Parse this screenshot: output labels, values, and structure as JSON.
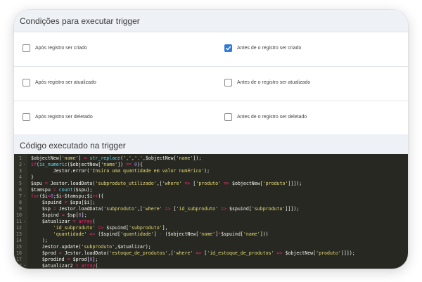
{
  "conditions": {
    "title": "Condições para executar trigger",
    "rows": [
      {
        "left": {
          "label": "Após registro ser criado",
          "checked": false
        },
        "right": {
          "label": "Antes de o registro ser criado",
          "checked": true
        }
      },
      {
        "left": {
          "label": "Após registro ser atualizado",
          "checked": false
        },
        "right": {
          "label": "Antes de o registro ser atualizado",
          "checked": false
        }
      },
      {
        "left": {
          "label": "Após registro ser deletado",
          "checked": false
        },
        "right": {
          "label": "Antes de o registro ser deletado",
          "checked": false
        }
      }
    ]
  },
  "code_section": {
    "title": "Código executado na trigger",
    "lines": [
      {
        "num": "1",
        "fold": "",
        "text": "$objectNew['name'] = str_replace(',','.',$objectNew['name']);"
      },
      {
        "num": "2",
        "fold": "-",
        "text": "if(is_numeric($objectNew['name']) == 0){"
      },
      {
        "num": "3",
        "fold": "",
        "text": "        Jestor.error('Insira uma quantidade em valor numérico');"
      },
      {
        "num": "4",
        "fold": "",
        "text": "}"
      },
      {
        "num": "5",
        "fold": "",
        "text": "$spu = Jestor.loadData('subproduto_utilizado',['where' => ['produto' => $objectNew['produto']]]);"
      },
      {
        "num": "6",
        "fold": "",
        "text": "$tamspu = count($spu);"
      },
      {
        "num": "7",
        "fold": "-",
        "text": "for($i=0;$i<$tamspu;$i++){"
      },
      {
        "num": "8",
        "fold": "",
        "text": "    $spuind = $spu[$i];"
      },
      {
        "num": "9",
        "fold": "",
        "text": "    $sp = Jestor.loadData('subproduto',['where' => ['id_subproduto' => $spuind['subproduto']]]);"
      },
      {
        "num": "10",
        "fold": "",
        "text": "    $spind = $sp[0];"
      },
      {
        "num": "11",
        "fold": "-",
        "text": "    $atualizar = array("
      },
      {
        "num": "12",
        "fold": "",
        "text": "        'id_subproduto' => $spuind['subproduto'],"
      },
      {
        "num": "13",
        "fold": "",
        "text": "        'quantidade' => ($spind['quantidade'] - ($objectNew['name']*$spuind['name']))"
      },
      {
        "num": "14",
        "fold": "",
        "text": "    );"
      },
      {
        "num": "15",
        "fold": "",
        "text": "    Jestor.update('subproduto',$atualizar);"
      },
      {
        "num": "16",
        "fold": "",
        "text": "    $prod = Jestor.loadData('estoque_de_produtos',['where' => ['id_estoque_de_produtos' => $objectNew['produto']]]);"
      },
      {
        "num": "17",
        "fold": "",
        "text": "    $prodind = $prod[0];"
      },
      {
        "num": "18",
        "fold": "-",
        "text": "    $atualizar2 = array("
      }
    ]
  },
  "colors": {
    "header_bg": "#eef1f6",
    "checkbox_checked": "#2f7bd9",
    "editor_bg": "#272822"
  }
}
